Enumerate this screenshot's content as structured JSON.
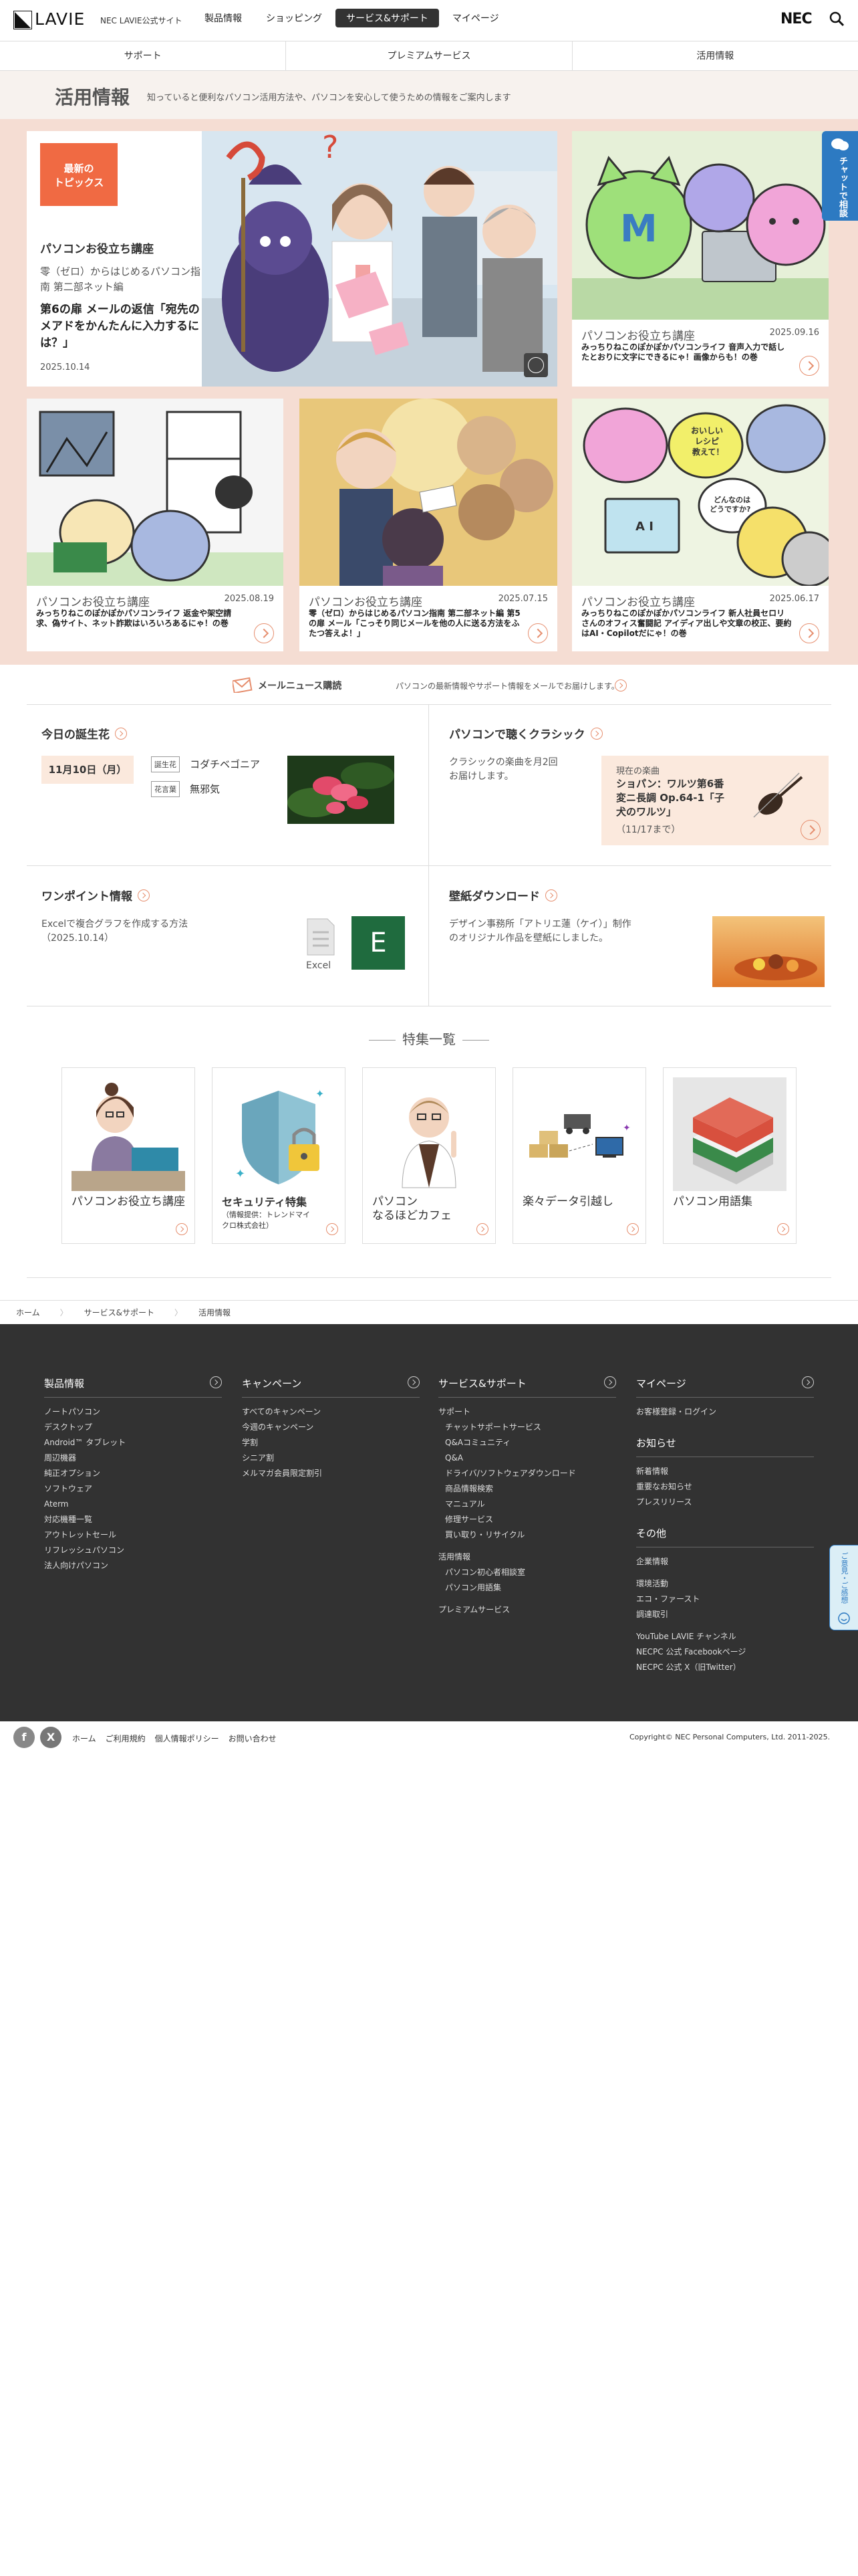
{
  "header": {
    "logo": "LAVIE",
    "site_name": "NEC LAVIE公式サイト",
    "nav": [
      "製品情報",
      "ショッピング",
      "サービス&サポート",
      "マイページ"
    ],
    "nec_logo": "NEC"
  },
  "subnav": [
    "サポート",
    "プレミアムサービス",
    "活用情報"
  ],
  "title": {
    "heading": "活用情報",
    "lead": "知っていると便利なパソコン活用方法や、パソコンを安心して使うための情報をご案内します"
  },
  "chat_tab": "チャットで相談",
  "featured": {
    "badge": "最新の\nトピックス",
    "main": {
      "category": "パソコンお役立ち講座",
      "series": "零（ゼロ）からはじめるパソコン指南 第二部ネット編",
      "headline": "第6の扉 メールの返信「宛先のメアドをかんたんに入力するには？」",
      "date": "2025.10.14"
    },
    "cards": [
      {
        "category": "パソコンお役立ち講座",
        "date": "2025.09.16",
        "desc": "みっちりねこのぽかぽかパソコンライフ 音声入力で話したとおりに文字にできるにゃ！画像からも！の巻"
      },
      {
        "category": "パソコンお役立ち講座",
        "date": "2025.08.19",
        "desc": "みっちりねこのぽかぽかパソコンライフ 返金や架空請求、偽サイト、ネット詐欺はいろいろあるにゃ！の巻"
      },
      {
        "category": "パソコンお役立ち講座",
        "date": "2025.07.15",
        "desc": "零（ゼロ）からはじめるパソコン指南 第二部ネット編 第5の扉 メール「こっそり同じメールを他の人に送る方法をふたつ答えよ！」"
      },
      {
        "category": "パソコンお役立ち講座",
        "date": "2025.06.17",
        "desc": "みっちりねこのぽかぽかパソコンライフ 新人社員セロリさんのオフィス奮闘記 アイディア出しや文章の校正、要約はAI・Copilotだにゃ！の巻"
      }
    ],
    "bubble1": "おいしい\nレシピ\n教えて！",
    "bubble2": "どんなのは\nどうですか?",
    "ai_label": "A I"
  },
  "mail": {
    "title": "メールニュース購読",
    "desc": "パソコンの最新情報やサポート情報をメールでお届けします。"
  },
  "birthday": {
    "heading": "今日の誕生花",
    "date": "11月10日（月）",
    "tag1": "誕生花",
    "flower": "コダチベゴニア",
    "tag2": "花言葉",
    "meaning": "無邪気"
  },
  "classic": {
    "heading": "パソコンで聴くクラシック",
    "desc": "クラシックの楽曲を月2回\nお届けします。",
    "now_label": "現在の楽曲",
    "song": "ショパン：ワルツ第6番\n変ニ長調 Op.64-1「子\n犬のワルツ」",
    "until": "（11/17まで）"
  },
  "onepoint": {
    "heading": "ワンポイント情報",
    "desc": "Excelで複合グラフを作成する方法\n（2025.10.14）",
    "icon_label": "Excel",
    "icon_letter": "E"
  },
  "wallpaper": {
    "heading": "壁紙ダウンロード",
    "desc": "デザイン事務所「アトリエ蓮（ケイ）」制作のオリジナル作品を壁紙にしました。"
  },
  "special": {
    "heading": "特集一覧",
    "items": [
      "パソコンお役立ち講座",
      "セキュリティ特集",
      "パソコン\nなるほどカフェ",
      "楽々データ引越し",
      "パソコン用語集"
    ],
    "sub": "（情報提供：トレンドマイクロ株式会社）"
  },
  "breadcrumb": [
    "ホーム",
    "サービス&サポート",
    "活用情報"
  ],
  "footer": {
    "col1": {
      "title": "製品情報",
      "items": [
        "ノートパソコン",
        "デスクトップ",
        "Android™ タブレット",
        "周辺機器",
        "純正オプション",
        "ソフトウェア",
        "Aterm",
        "対応機種一覧",
        "アウトレットセール",
        "リフレッシュパソコン",
        "法人向けパソコン"
      ]
    },
    "col2": {
      "title": "キャンペーン",
      "items": [
        "すべてのキャンペーン",
        "今週のキャンペーン",
        "学割",
        "シニア割",
        "メルマガ会員限定割引"
      ]
    },
    "col3": {
      "title": "サービス&サポート",
      "items": [
        "サポート",
        "チャットサポートサービス",
        "Q&Aコミュニティ",
        "Q&A",
        "ドライバ/ソフトウェアダウンロード",
        "商品情報検索",
        "マニュアル",
        "修理サービス",
        "買い取り・リサイクル",
        "活用情報",
        "パソコン初心者相談室",
        "パソコン用語集",
        "プレミアムサービス"
      ]
    },
    "col4": {
      "title": "マイページ",
      "items": [
        "お客様登録・ログイン"
      ],
      "news_title": "お知らせ",
      "news": [
        "新着情報",
        "重要なお知らせ",
        "プレスリリース"
      ],
      "other_title": "その他",
      "other": [
        "企業情報",
        "環境活動",
        "エコ・ファースト",
        "調達取引",
        "YouTube LAVIE チャンネル",
        "NECPC 公式 Facebookページ",
        "NECPC 公式 X（旧Twitter）"
      ]
    }
  },
  "bottom": {
    "links": [
      "ホーム",
      "ご利用規約",
      "個人情報ポリシー",
      "お問い合わせ"
    ],
    "copyright": "Copyright© NEC Personal Computers, Ltd. 2011-2025."
  },
  "feedback_tab": "ご意見・ご感想"
}
